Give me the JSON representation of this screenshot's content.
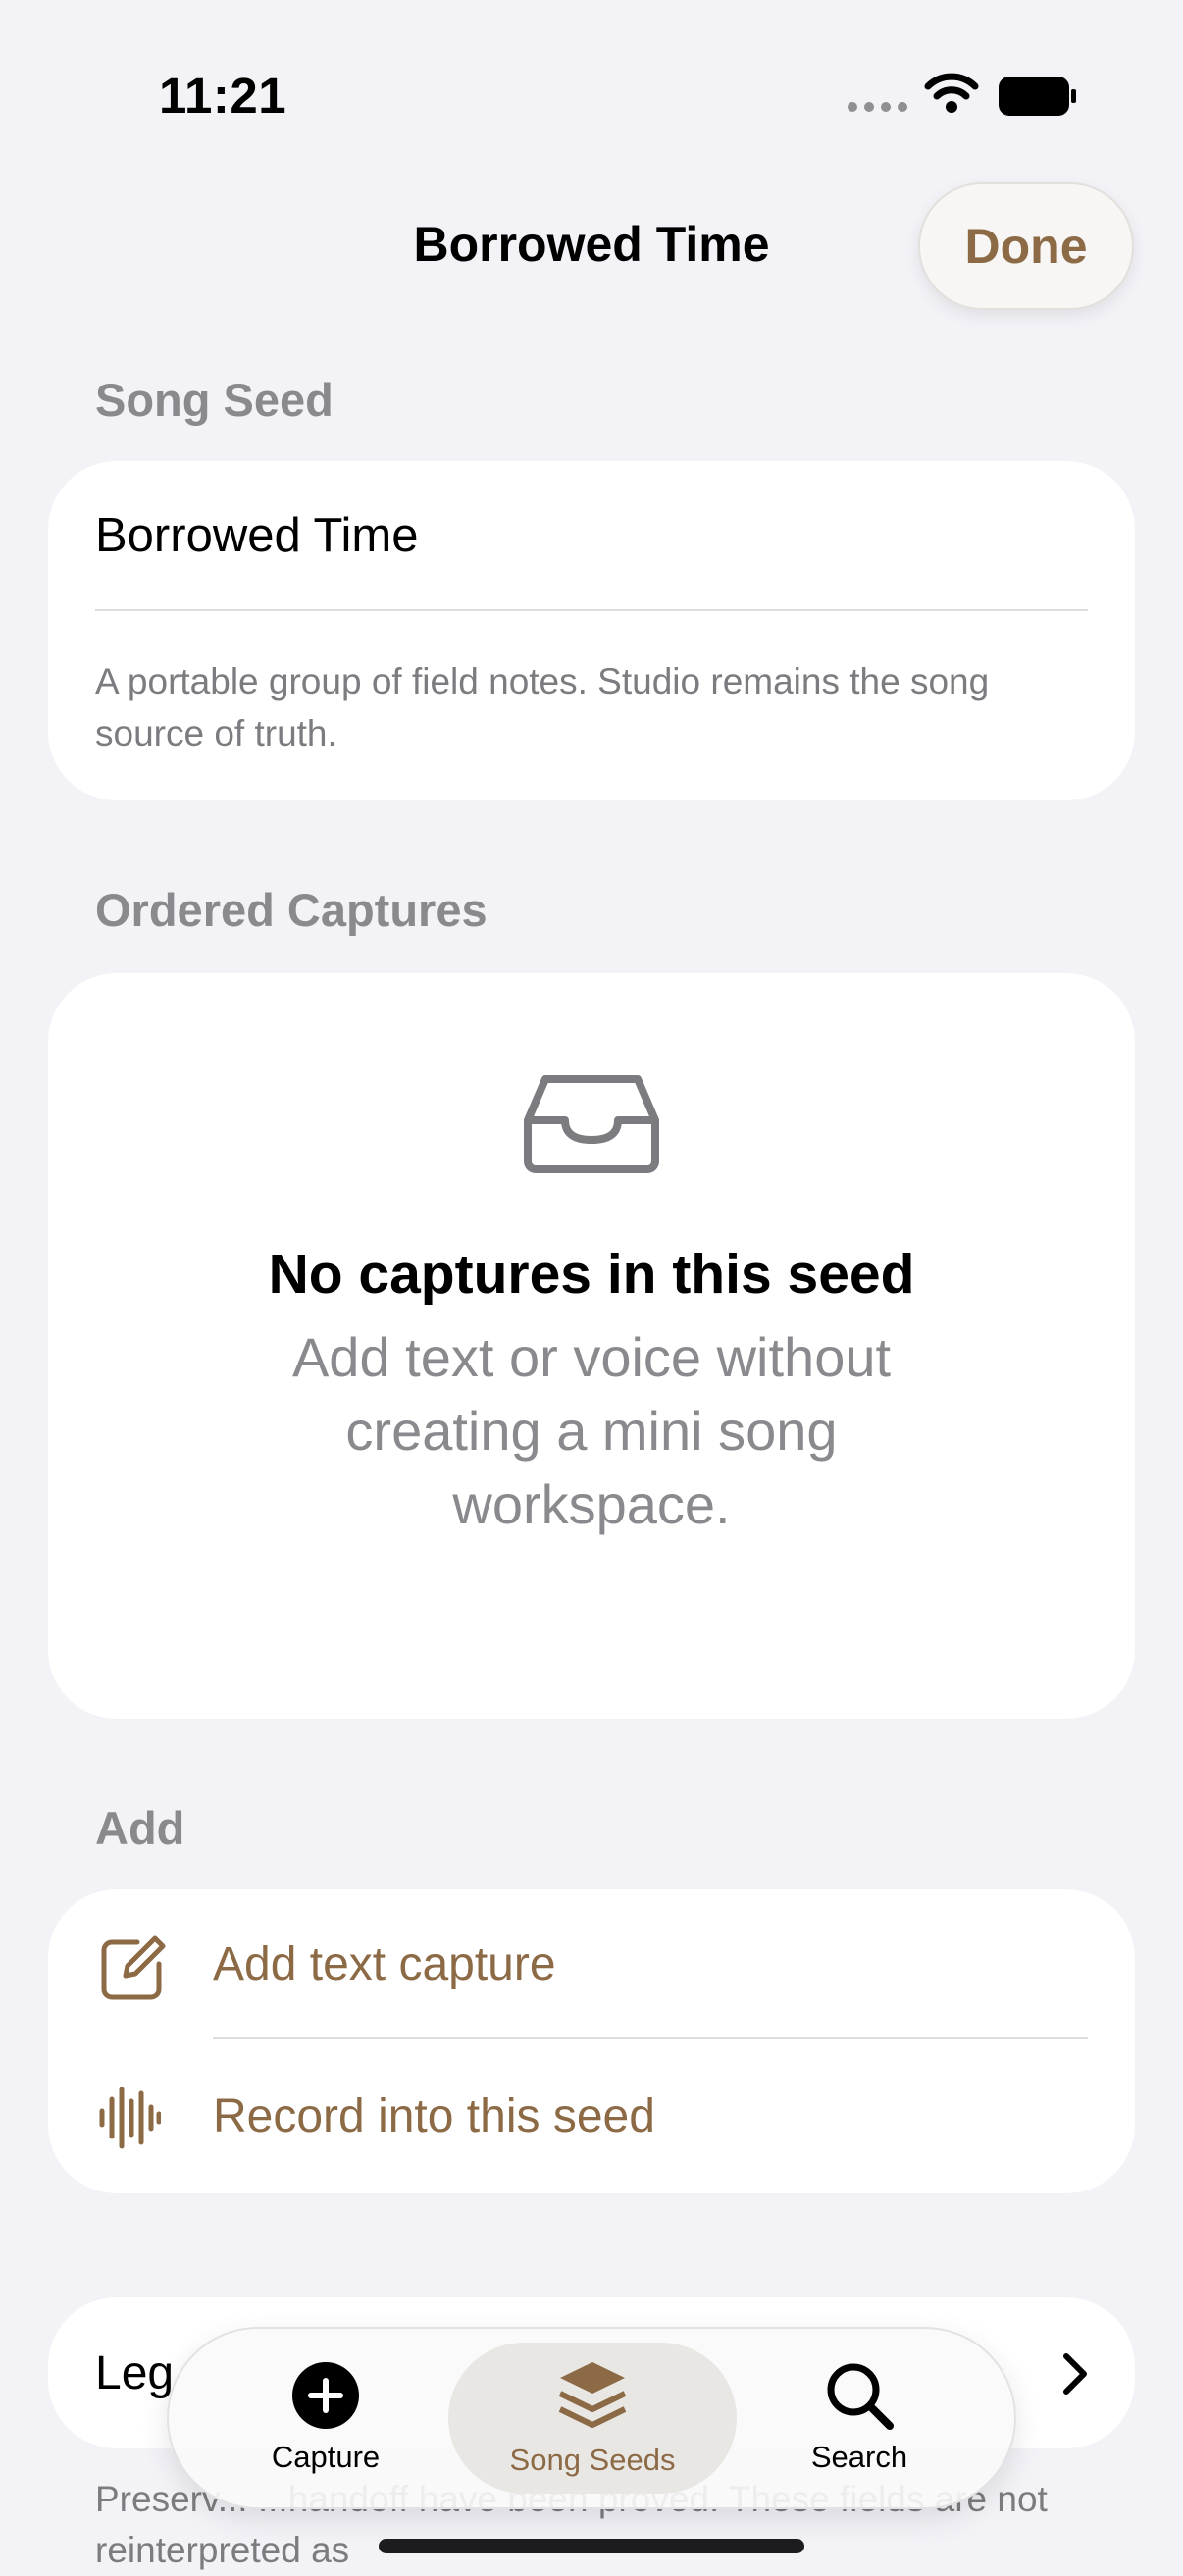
{
  "status_bar": {
    "time": "11:21"
  },
  "nav": {
    "title": "Borrowed Time",
    "done_label": "Done"
  },
  "song_seed": {
    "header": "Song Seed",
    "name_value": "Borrowed Time",
    "description": "A portable group of field notes. Studio remains the song source of truth."
  },
  "ordered_captures": {
    "header": "Ordered Captures",
    "empty_title": "No captures in this seed",
    "empty_subtitle": "Add text or voice without creating a mini song workspace."
  },
  "add": {
    "header": "Add",
    "items": [
      {
        "label": "Add text capture",
        "icon": "square-and-pencil-icon"
      },
      {
        "label": "Record into this seed",
        "icon": "waveform-icon"
      }
    ]
  },
  "legacy": {
    "label": "Leg",
    "footer": "Preserv... ...handoff have been proved. These fields are not reinterpreted as"
  },
  "tab_bar": {
    "tabs": [
      {
        "label": "Capture",
        "icon": "plus-circle-icon"
      },
      {
        "label": "Song Seeds",
        "icon": "stack-icon",
        "selected": true
      },
      {
        "label": "Search",
        "icon": "magnifier-icon"
      }
    ]
  },
  "colors": {
    "accent": "#8c6a45",
    "background": "#f2f2f7",
    "secondary_text": "#8a8a8e"
  }
}
